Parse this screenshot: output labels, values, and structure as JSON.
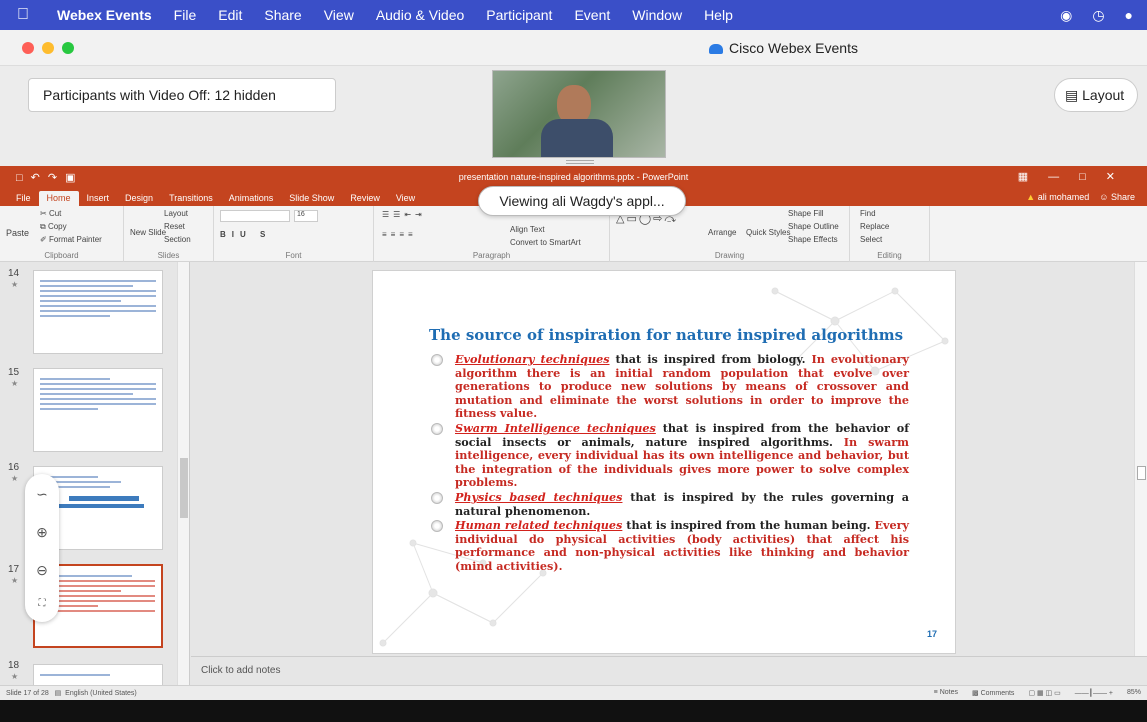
{
  "menubar": {
    "app": "Webex Events",
    "items": [
      "File",
      "Edit",
      "Share",
      "View",
      "Audio & Video",
      "Participant",
      "Event",
      "Window",
      "Help"
    ]
  },
  "window": {
    "title": "Cisco Webex Events"
  },
  "stage": {
    "hidden_label": "Participants with Video Off: 12 hidden",
    "layout_label": "Layout",
    "viewing_toast": "Viewing ali Wagdy's appl..."
  },
  "ppt": {
    "doc_title": "presentation nature-inspired algorithms.pptx - PowerPoint",
    "tabs": [
      "File",
      "Home",
      "Insert",
      "Design",
      "Transitions",
      "Animations",
      "Slide Show",
      "Review",
      "View"
    ],
    "user": "ali mohamed",
    "share": "Share",
    "ribbon": {
      "clipboard": {
        "name": "Clipboard",
        "paste": "Paste",
        "cut": "Cut",
        "copy": "Copy",
        "format_painter": "Format Painter"
      },
      "slides": {
        "name": "Slides",
        "new_slide": "New Slide",
        "layout": "Layout",
        "reset": "Reset",
        "section": "Section"
      },
      "font": {
        "name": "Font",
        "size": "16"
      },
      "paragraph": {
        "name": "Paragraph",
        "align_text": "Align Text",
        "smartart": "Convert to SmartArt"
      },
      "drawing": {
        "name": "Drawing",
        "arrange": "Arrange",
        "quick_styles": "Quick Styles",
        "shape_fill": "Shape Fill",
        "shape_outline": "Shape Outline",
        "shape_effects": "Shape Effects"
      },
      "editing": {
        "name": "Editing",
        "find": "Find",
        "replace": "Replace",
        "select": "Select"
      }
    },
    "thumbnails": [
      {
        "num": "14"
      },
      {
        "num": "15"
      },
      {
        "num": "16"
      },
      {
        "num": "17"
      },
      {
        "num": "18"
      }
    ],
    "slide": {
      "title": "The source of inspiration for nature inspired algorithms",
      "bullets": [
        {
          "term": "Evolutionary techniques",
          "dark": " that is inspired from biology.",
          "red": " In evolutionary algorithm there is an initial random population that evolve over generations to produce new solutions by means of crossover and mutation and eliminate the worst solutions in order to improve the fitness value."
        },
        {
          "term": "Swarm Intelligence techniques",
          "dark": " that is inspired from the behavior of social insects or animals, nature inspired algorithms.",
          "red": " In swarm intelligence, every individual has its own intelligence and behavior, but the integration of the individuals gives more power to solve complex problems."
        },
        {
          "term": "Physics based techniques",
          "dark": " that is inspired by the rules governing a natural phenomenon.",
          "red": ""
        },
        {
          "term": "Human related techniques",
          "dark": " that is inspired from the human being.",
          "red": " Every individual do physical activities (body activities) that affect his performance and non-physical activities like thinking and behavior (mind activities)."
        }
      ],
      "number": "17"
    },
    "notes_placeholder": "Click to add notes",
    "status": {
      "slide_of": "Slide 17 of 28",
      "language": "English (United States)",
      "notes": "Notes",
      "comments": "Comments",
      "zoom": "85%"
    }
  }
}
